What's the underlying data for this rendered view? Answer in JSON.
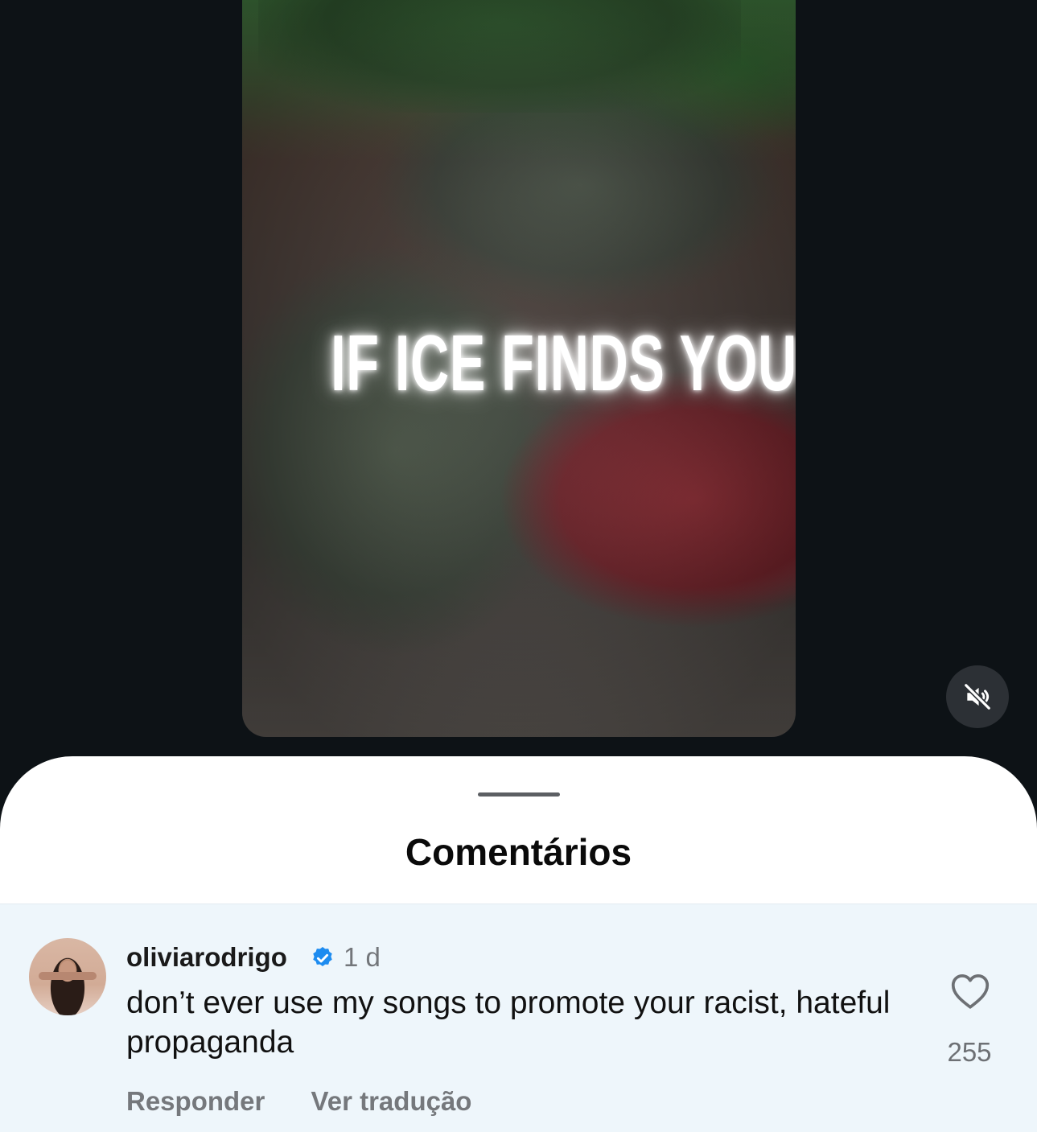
{
  "video": {
    "overlay_text": "IF ICE FINDS YOU",
    "mute_icon": "speaker-muted-icon"
  },
  "sheet": {
    "title": "Comentários"
  },
  "comment": {
    "username": "oliviarodrigo",
    "verified_icon": "verified-badge-icon",
    "time": "1 d",
    "text": "don’t ever use my songs to promote your racist, hateful propaganda",
    "reply_label": "Responder",
    "translate_label": "Ver tradução",
    "like_icon": "heart-icon",
    "like_count": "255"
  },
  "colors": {
    "background": "#0d1216",
    "sheet": "#ffffff",
    "comment_highlight": "#eef6fb",
    "verified": "#1d8cf0"
  }
}
